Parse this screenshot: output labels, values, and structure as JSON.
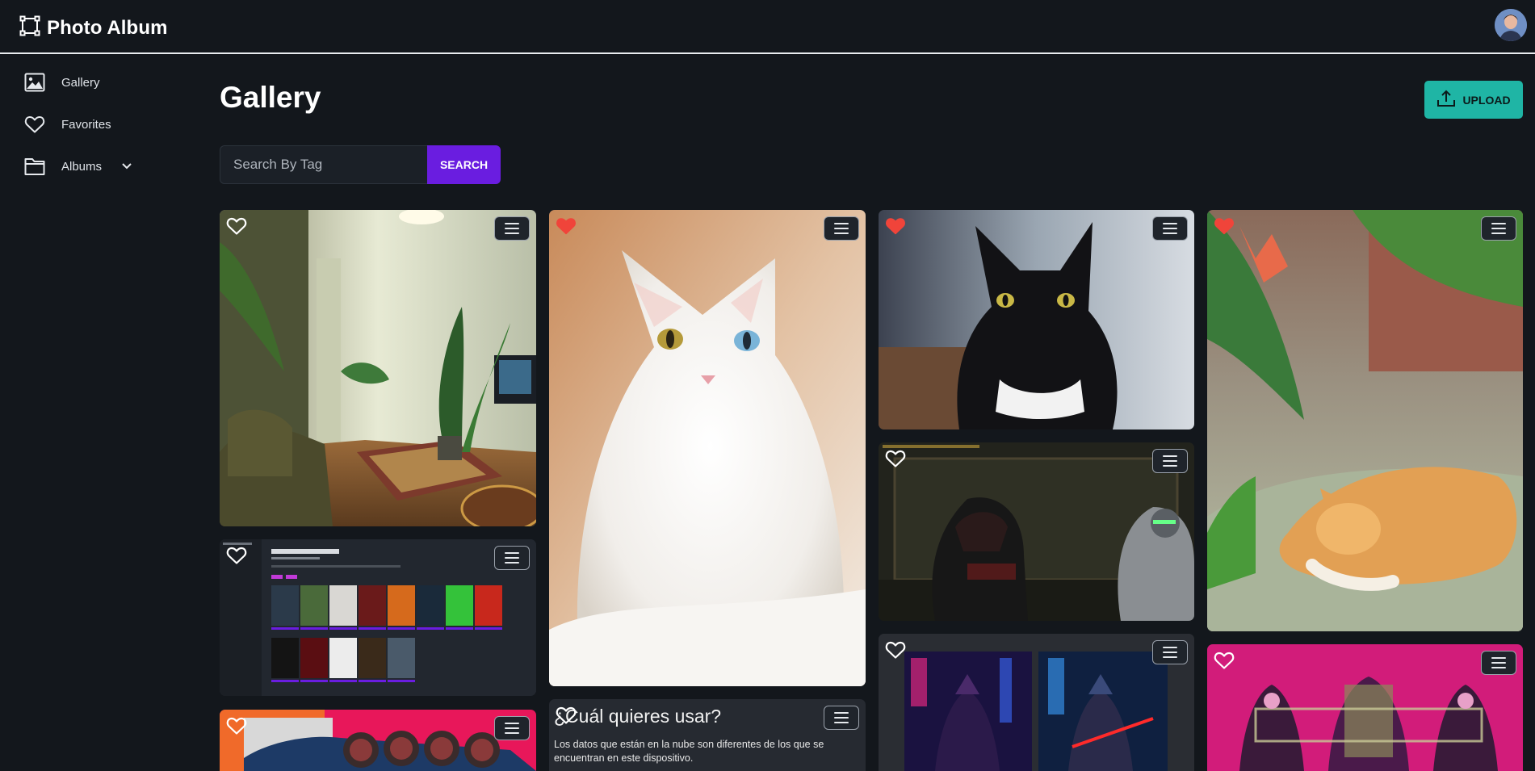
{
  "app": {
    "title": "Photo Album"
  },
  "sidebar": {
    "items": [
      {
        "label": "Gallery",
        "icon": "image-icon"
      },
      {
        "label": "Favorites",
        "icon": "heart-outline-icon"
      },
      {
        "label": "Albums",
        "icon": "folder-icon",
        "expandable": true
      }
    ]
  },
  "main": {
    "title": "Gallery",
    "upload_label": "UPLOAD",
    "search": {
      "placeholder": "Search By Tag",
      "button_label": "SEARCH"
    }
  },
  "cards": [
    {
      "name": "photo-living-room",
      "favorite": false
    },
    {
      "name": "photo-book-list-screenshot",
      "favorite": false
    },
    {
      "name": "photo-red-car",
      "favorite": true
    },
    {
      "name": "photo-white-cat",
      "favorite": true
    },
    {
      "name": "photo-spanish-dialog",
      "favorite": false,
      "title_text": "¿Cuál quieres usar?",
      "body_text": "Los datos que están en la nube son diferentes de los que se encuentran en este dispositivo."
    },
    {
      "name": "photo-black-cat",
      "favorite": true
    },
    {
      "name": "photo-dead-space-game",
      "favorite": false
    },
    {
      "name": "photo-samurai-neon",
      "favorite": false
    },
    {
      "name": "photo-orange-cat",
      "favorite": true
    },
    {
      "name": "photo-pink-anime",
      "favorite": false
    }
  ],
  "colors": {
    "background": "#13171c",
    "accent_primary": "#6a1de0",
    "accent_upload": "#1fb5a5",
    "favorite_red": "#f0443a"
  }
}
